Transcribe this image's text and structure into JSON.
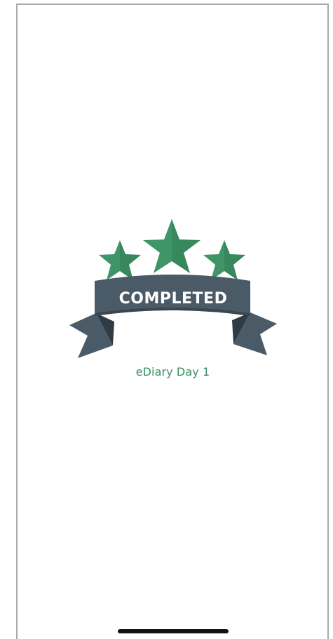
{
  "badge": {
    "label": "COMPLETED",
    "colors": {
      "star": "#3f9567",
      "star_shadow": "#2f7a52",
      "ribbon": "#4a5a67",
      "ribbon_dark": "#2f3a43"
    }
  },
  "caption": "eDiary Day 1",
  "colors": {
    "caption": "#3a8d66",
    "home_indicator": "#111111"
  }
}
